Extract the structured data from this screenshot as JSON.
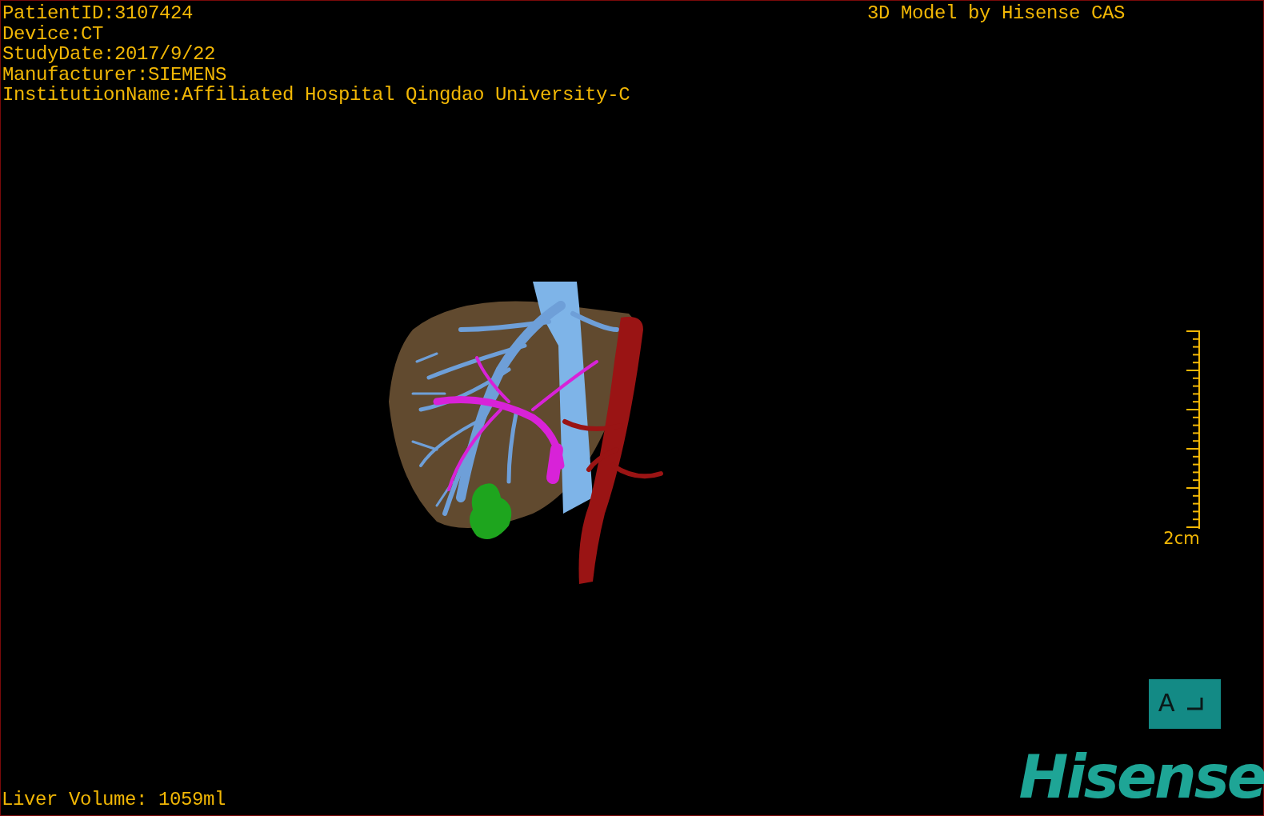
{
  "study_info": [
    "PatientID:3107424",
    "Device:CT",
    "StudyDate:2017/9/22",
    "Manufacturer:SIEMENS",
    "InstitutionName:Affiliated Hospital Qingdao University-C"
  ],
  "title": "3D Model by Hisense CAS",
  "scale_bar": {
    "label": "2cm"
  },
  "liver_volume": "Liver Volume: 1059ml",
  "orientation": {
    "label": "A"
  },
  "logo": "Hisense"
}
